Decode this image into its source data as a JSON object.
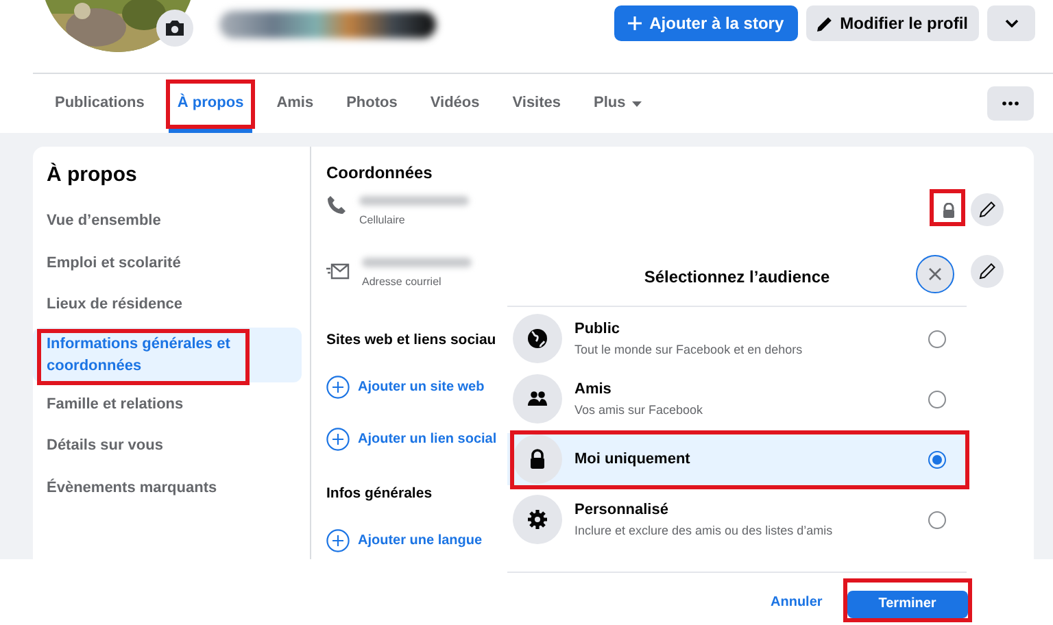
{
  "header_buttons": [
    {
      "kind": "primary",
      "label": "Ajouter à la story"
    },
    {
      "kind": "secondary",
      "label": "Modifier le profil"
    },
    {
      "kind": "dropdown"
    }
  ],
  "tabs": [
    {
      "label": "Publications",
      "selected": false,
      "highlighted": false
    },
    {
      "label": "À propos",
      "selected": true,
      "highlighted": true
    },
    {
      "label": "Amis",
      "selected": false,
      "highlighted": false
    },
    {
      "label": "Photos",
      "selected": false,
      "highlighted": false
    },
    {
      "label": "Vidéos",
      "selected": false,
      "highlighted": false
    },
    {
      "label": "Visites",
      "selected": false,
      "highlighted": false
    },
    {
      "label": "Plus",
      "selected": false,
      "highlighted": false
    }
  ],
  "sidebar": {
    "title": "À propos",
    "items": [
      {
        "label": "Vue d’ensemble",
        "selected": false,
        "highlighted": false
      },
      {
        "label": "Emploi et scolarité",
        "selected": false,
        "highlighted": false
      },
      {
        "label": "Lieux de résidence",
        "selected": false,
        "highlighted": false
      },
      {
        "label": "Informations générales et coordonnées",
        "selected": true,
        "highlighted": true
      },
      {
        "label": "Famille et relations",
        "selected": false,
        "highlighted": false
      },
      {
        "label": "Détails sur vous",
        "selected": false,
        "highlighted": false
      },
      {
        "label": "Évènements marquants",
        "selected": false,
        "highlighted": false
      }
    ]
  },
  "contact": {
    "title": "Coordonnées",
    "entries": [
      {
        "kind": "phone",
        "caption": "Cellulaire",
        "privacy": {
          "highlighted": true
        }
      },
      {
        "kind": "email",
        "caption": "Adresse courriel"
      }
    ]
  },
  "sections": [
    {
      "title": "Sites web et liens sociau",
      "links": [
        "Ajouter un site web",
        "Ajouter un lien social"
      ]
    },
    {
      "title": "Infos générales",
      "links": [
        "Ajouter une langue"
      ]
    }
  ],
  "audience_dialog": {
    "title": "Sélectionnez l’audience",
    "options": [
      {
        "kind": "globe",
        "label": "Public",
        "description": "Tout le monde sur Facebook et en dehors",
        "selected": false,
        "highlighted": false
      },
      {
        "kind": "friends",
        "label": "Amis",
        "description": "Vos amis sur Facebook",
        "selected": false,
        "highlighted": false
      },
      {
        "kind": "lock",
        "label": "Moi uniquement",
        "selected": true,
        "highlighted": true
      },
      {
        "kind": "gear",
        "label": "Personnalisé",
        "description": "Inclure et exclure des amis ou des listes d’amis",
        "selected": false,
        "highlighted": false
      }
    ],
    "cancel": "Annuler",
    "confirm": {
      "label": "Terminer",
      "highlighted": true
    }
  }
}
